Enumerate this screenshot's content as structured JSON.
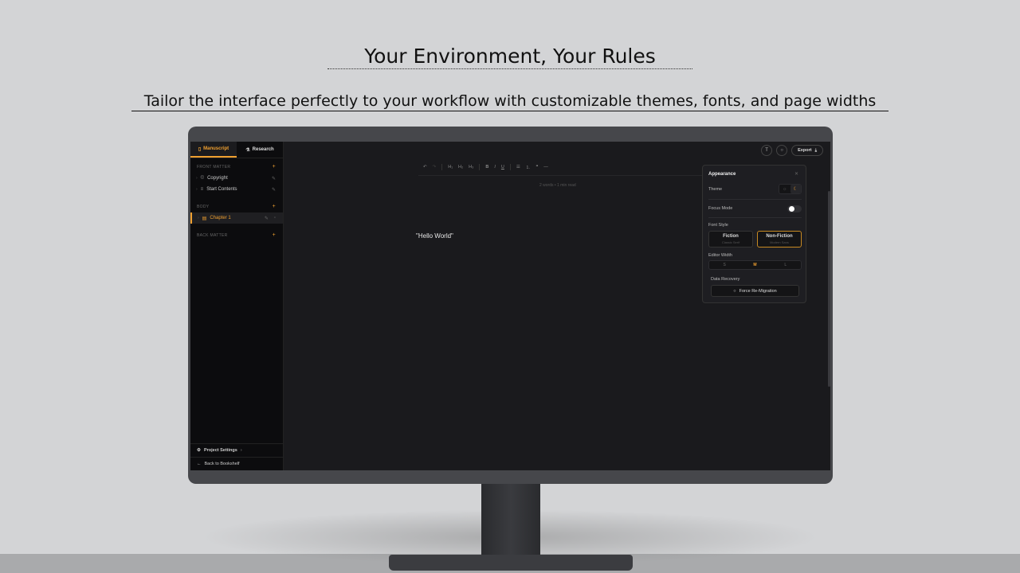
{
  "headline": "Your Environment, Your Rules",
  "subheadline": "Tailor the interface perfectly to your workflow with customizable themes, fonts, and page widths",
  "sidebar": {
    "tabs": [
      {
        "label": "Manuscript",
        "icon": "book-icon"
      },
      {
        "label": "Research",
        "icon": "flask-icon"
      }
    ],
    "sections": {
      "front": {
        "label": "FRONT MATTER",
        "items": [
          {
            "label": "Copyright",
            "icon": "copyright-icon"
          },
          {
            "label": "Start Contents",
            "icon": "list-icon"
          }
        ]
      },
      "body": {
        "label": "BODY",
        "items": [
          {
            "label": "Chapter 1",
            "icon": "document-icon"
          }
        ]
      },
      "back": {
        "label": "BACK MATTER"
      }
    },
    "project_settings": "Project Settings",
    "back_link": "Back to Bookshelf"
  },
  "topbar": {
    "export_label": "Export"
  },
  "toolbar": {
    "h1": "H₁",
    "h2": "H₂",
    "h3": "H₃",
    "bold": "B",
    "italic": "I",
    "underline": "U"
  },
  "editor": {
    "meta": "2 words • 1 min read",
    "content": "\"Hello World\""
  },
  "appearance": {
    "title": "Appearance",
    "theme_label": "Theme",
    "focus_label": "Focus Mode",
    "focus_on": false,
    "font_style_label": "Font Style",
    "fonts": [
      {
        "title": "Fiction",
        "sub": "Classic Serif",
        "active": false
      },
      {
        "title": "Non-Fiction",
        "sub": "Modern Sans",
        "active": true
      }
    ],
    "width_label": "Editor Width",
    "widths": [
      "S",
      "M",
      "L"
    ],
    "width_selected": "M",
    "recovery_label": "Data Recovery",
    "recovery_button": "Force Re-Migration"
  },
  "colors": {
    "accent": "#f0a030",
    "background": "#1a1a1d",
    "sidebar": "#0c0c0e",
    "panel": "#1e1e22"
  }
}
